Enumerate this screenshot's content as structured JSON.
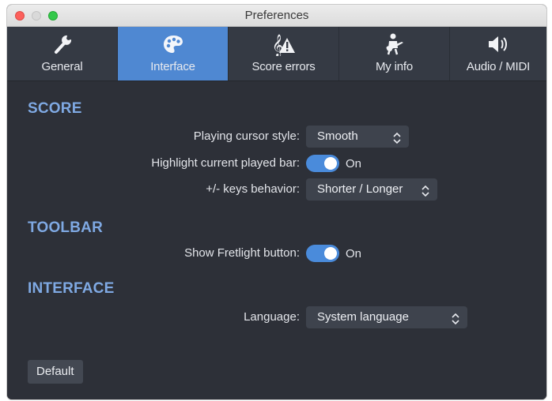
{
  "window": {
    "title": "Preferences"
  },
  "tabs": [
    {
      "label": "General",
      "icon": "wrench-icon",
      "active": false
    },
    {
      "label": "Interface",
      "icon": "palette-icon",
      "active": true
    },
    {
      "label": "Score errors",
      "icon": "clef-warning-icon",
      "active": false
    },
    {
      "label": "My info",
      "icon": "guitarist-icon",
      "active": false
    },
    {
      "label": "Audio / MIDI",
      "icon": "speaker-icon",
      "active": false
    }
  ],
  "score": {
    "heading": "SCORE",
    "cursor_style": {
      "label": "Playing cursor style:",
      "value": "Smooth"
    },
    "highlight_bar": {
      "label": "Highlight current played bar:",
      "state": "On"
    },
    "keys_behavior": {
      "label": "+/- keys behavior:",
      "value": "Shorter / Longer"
    }
  },
  "toolbar": {
    "heading": "TOOLBAR",
    "fretlight": {
      "label": "Show Fretlight button:",
      "state": "On"
    }
  },
  "interface": {
    "heading": "INTERFACE",
    "language": {
      "label": "Language:",
      "value": "System language"
    }
  },
  "footer": {
    "default_label": "Default"
  },
  "colors": {
    "accent": "#4f88d2",
    "heading": "#7fa9e3",
    "background": "#2d3038"
  }
}
